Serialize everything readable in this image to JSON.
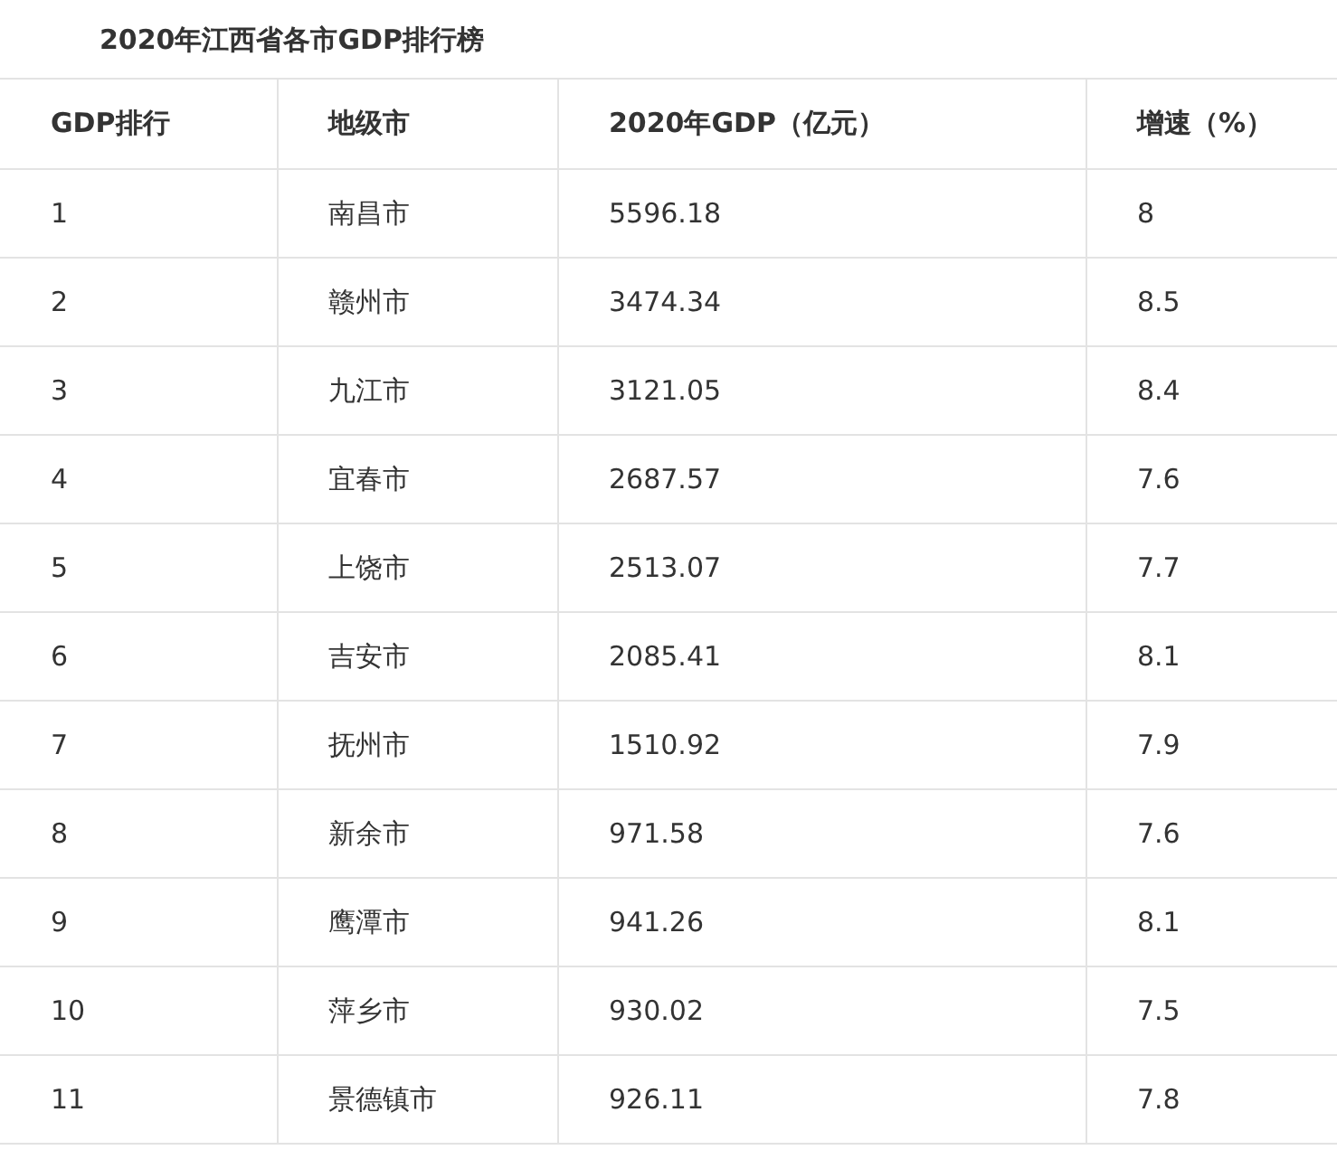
{
  "title": "2020年江西省各市GDP排行榜",
  "table": {
    "columns": [
      "GDP排行",
      "地级市",
      "2020年GDP（亿元）",
      "增速（%）"
    ],
    "rows": [
      [
        "1",
        "南昌市",
        "5596.18",
        "8"
      ],
      [
        "2",
        "赣州市",
        "3474.34",
        "8.5"
      ],
      [
        "3",
        "九江市",
        "3121.05",
        "8.4"
      ],
      [
        "4",
        "宜春市",
        "2687.57",
        "7.6"
      ],
      [
        "5",
        "上饶市",
        "2513.07",
        "7.7"
      ],
      [
        "6",
        "吉安市",
        "2085.41",
        "8.1"
      ],
      [
        "7",
        "抚州市",
        "1510.92",
        "7.9"
      ],
      [
        "8",
        "新余市",
        "971.58",
        "7.6"
      ],
      [
        "9",
        "鹰潭市",
        "941.26",
        "8.1"
      ],
      [
        "10",
        "萍乡市",
        "930.02",
        "7.5"
      ],
      [
        "11",
        "景德镇市",
        "926.11",
        "7.8"
      ]
    ]
  }
}
